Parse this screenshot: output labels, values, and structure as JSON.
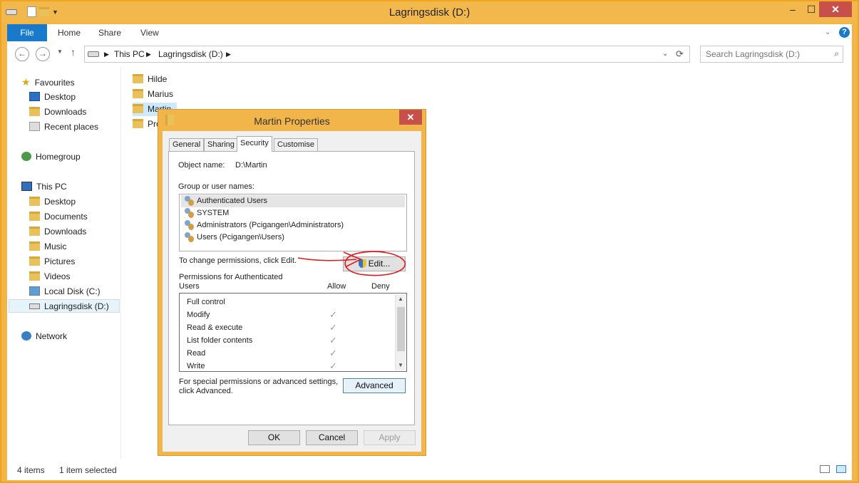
{
  "window": {
    "title": "Lagringsdisk (D:)",
    "minimize": "–",
    "maximize": "☐",
    "close": "✕"
  },
  "ribbon": {
    "tabs": [
      "File",
      "Home",
      "Share",
      "View"
    ]
  },
  "address": {
    "crumbs": [
      "This PC",
      "Lagringsdisk (D:)"
    ],
    "search_placeholder": "Search Lagringsdisk (D:)"
  },
  "nav": {
    "favourites": "Favourites",
    "fav_items": [
      "Desktop",
      "Downloads",
      "Recent places"
    ],
    "homegroup": "Homegroup",
    "thispc": "This PC",
    "pc_items": [
      "Desktop",
      "Documents",
      "Downloads",
      "Music",
      "Pictures",
      "Videos",
      "Local Disk (C:)",
      "Lagringsdisk (D:)"
    ],
    "network": "Network"
  },
  "files": [
    "Hilde",
    "Marius",
    "Martin",
    "Pro"
  ],
  "status": {
    "items": "4 items",
    "selected": "1 item selected"
  },
  "dialog": {
    "title": "Martin Properties",
    "close": "✕",
    "tabs": [
      "General",
      "Sharing",
      "Security",
      "Customise"
    ],
    "object_label": "Object name:",
    "object_value": "D:\\Martin",
    "group_label": "Group or user names:",
    "users": [
      "Authenticated Users",
      "SYSTEM",
      "Administrators (Pcigangen\\Administrators)",
      "Users (Pcigangen\\Users)"
    ],
    "change_text": "To change permissions, click Edit.",
    "edit_button": "Edit...",
    "perm_for_line1": "Permissions for Authenticated",
    "perm_for_line2": "Users",
    "allow": "Allow",
    "deny": "Deny",
    "permissions": [
      {
        "name": "Full control",
        "allow": ""
      },
      {
        "name": "Modify",
        "allow": "✓"
      },
      {
        "name": "Read & execute",
        "allow": "✓"
      },
      {
        "name": "List folder contents",
        "allow": "✓"
      },
      {
        "name": "Read",
        "allow": "✓"
      },
      {
        "name": "Write",
        "allow": "✓"
      }
    ],
    "special_line1": "For special permissions or advanced settings,",
    "special_line2": "click Advanced.",
    "advanced_button": "Advanced",
    "ok": "OK",
    "cancel": "Cancel",
    "apply": "Apply"
  },
  "colors": {
    "accent_file_tab": "#1979ca",
    "window_frame": "#f1b54a",
    "close_button": "#c7504a",
    "annotation": "#e0191b"
  }
}
